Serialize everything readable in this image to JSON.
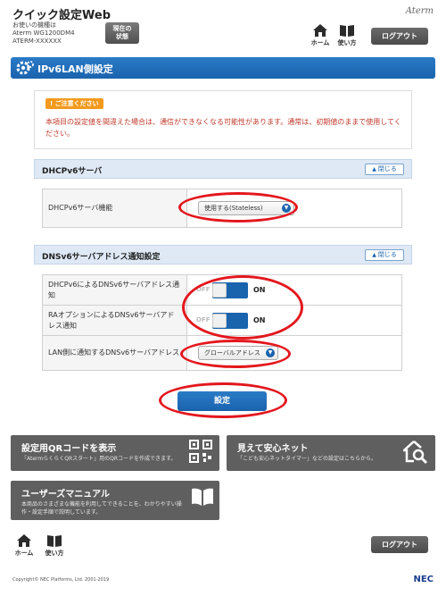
{
  "header": {
    "app_title": "クイック設定Web",
    "device_caption": "お使いの機種は",
    "device_model": "Aterm WG1200DM4",
    "device_serial": "ATERM-XXXXXX",
    "status_button": "現在の\n状態",
    "brand": "Aterm",
    "home_label": "ホーム",
    "manual_label": "使い方",
    "logout_label": "ログアウト"
  },
  "page": {
    "title": "IPv6LAN側設定"
  },
  "notice": {
    "badge": "! ご注意ください",
    "text": "本項目の設定値を間違えた場合は、通信ができなくなる可能性があります。通常は、初期値のままで使用してください。"
  },
  "dhcp_section": {
    "title": "DHCPv6サーバ",
    "close_label": "閉じる",
    "row_label": "DHCPv6サーバ機能",
    "row_value": "使用する(Stateless)"
  },
  "dns_section": {
    "title": "DNSv6サーバアドレス通知設定",
    "close_label": "閉じる",
    "rows": [
      {
        "label": "DHCPv6によるDNSv6サーバアドレス通知",
        "off": "OFF",
        "on": "ON"
      },
      {
        "label": "RAオプションによるDNSv6サーバアドレス通知",
        "off": "OFF",
        "on": "ON"
      },
      {
        "label": "LAN側に通知するDNSv6サーバアドレス",
        "value": "グローバルアドレス"
      }
    ]
  },
  "actions": {
    "submit_label": "設定"
  },
  "tiles": {
    "qr": {
      "title": "設定用QRコードを表示",
      "desc": "「AtermらくらくQRスタート」用のQRコードを作成できます。"
    },
    "safety": {
      "title": "見えて安心ネット",
      "desc": "「こども安心ネットタイマー」などの設定はこちらから。"
    },
    "manual": {
      "title": "ユーザーズマニュアル",
      "desc": "本商品のさまざまな機能を利用してできることを、わかりやすい操作・設定手順で説明しています。"
    }
  },
  "footer": {
    "home_label": "ホーム",
    "manual_label": "使い方",
    "logout_label": "ログアウト",
    "copyright": "Copyright© NEC Platforms, Ltd. 2001-2019",
    "brand": "NEC"
  },
  "colors": {
    "primary_blue": "#1a63ad",
    "highlight_red": "#e3171d",
    "warning_orange": "#f39a1e",
    "notice_text": "#c0392b",
    "tile_gray": "#5f5f5f"
  },
  "icons": [
    "gear-icon",
    "home-icon",
    "book-icon",
    "chevron-down-icon",
    "chevron-up-icon",
    "qr-code-icon",
    "house-search-icon",
    "open-book-icon"
  ]
}
